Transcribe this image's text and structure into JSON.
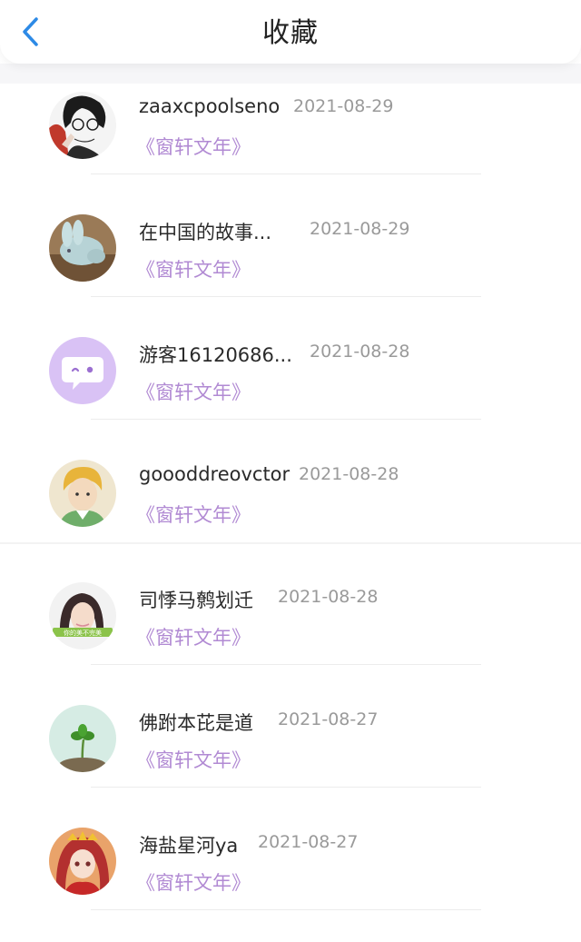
{
  "header": {
    "title": "收藏",
    "back_icon": "chevron-left-icon",
    "accent_color": "#2d8ae6"
  },
  "items": [
    {
      "name": "zaaxcpoolseno",
      "date": "2021-08-29",
      "book": "《窗轩文年》",
      "avatar": "anime-sketch-avatar"
    },
    {
      "name": "在中国的故事...",
      "date": "2021-08-29",
      "book": "《窗轩文年》",
      "avatar": "rabbit-figurine-avatar"
    },
    {
      "name": "游客16120686...",
      "date": "2021-08-28",
      "book": "《窗轩文年》",
      "avatar": "default-chat-bubble-avatar"
    },
    {
      "name": "goooddreovctor",
      "date": "2021-08-28",
      "book": "《窗轩文年》",
      "avatar": "anime-boy-avatar"
    },
    {
      "name": "司悸马鹩划迁",
      "date": "2021-08-28",
      "book": "《窗轩文年》",
      "avatar": "girl-photo-avatar",
      "avatar_caption": "你的美不完美"
    },
    {
      "name": "佛跗本芘是道",
      "date": "2021-08-27",
      "book": "《窗轩文年》",
      "avatar": "clover-sprout-avatar"
    },
    {
      "name": "海盐星河ya",
      "date": "2021-08-27",
      "book": "《窗轩文年》",
      "avatar": "anime-girl-red-avatar"
    }
  ],
  "colors": {
    "book_title": "#b18ad3",
    "date_text": "#9a9a9a",
    "default_avatar_bg": "#d9c2f5"
  }
}
